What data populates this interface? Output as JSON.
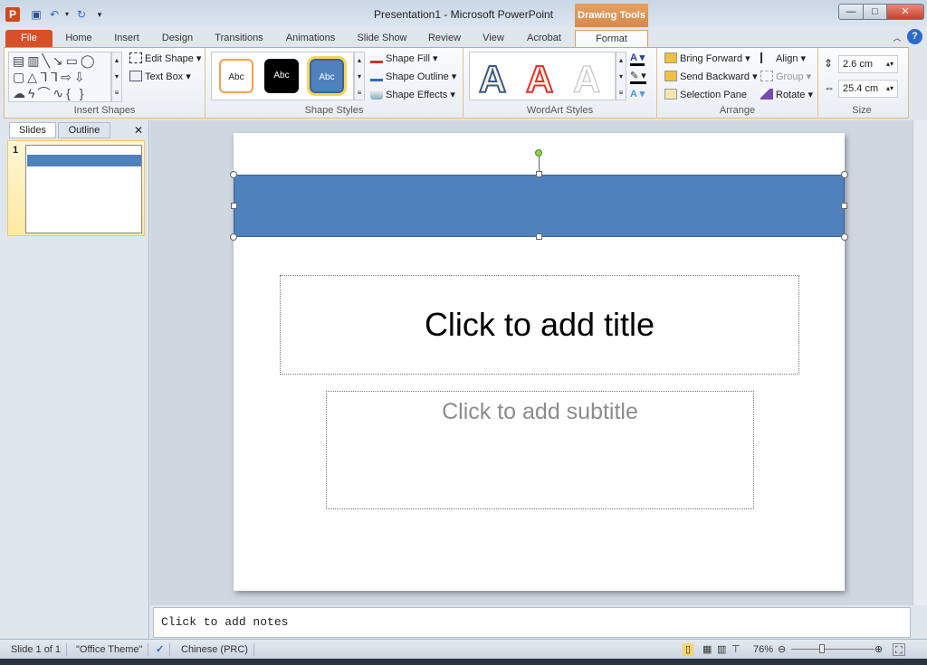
{
  "window": {
    "title": "Presentation1  -  Microsoft PowerPoint",
    "contextual_tab_group": "Drawing Tools",
    "controls": {
      "minimize": "—",
      "maximize": "□",
      "close": "✕"
    }
  },
  "quick_access": {
    "app_icon": "P",
    "save": "save-icon",
    "undo": "undo-icon",
    "redo": "redo-icon",
    "customize": "▾"
  },
  "tabs": [
    {
      "label": "File"
    },
    {
      "label": "Home"
    },
    {
      "label": "Insert"
    },
    {
      "label": "Design"
    },
    {
      "label": "Transitions"
    },
    {
      "label": "Animations"
    },
    {
      "label": "Slide Show"
    },
    {
      "label": "Review"
    },
    {
      "label": "View"
    },
    {
      "label": "Acrobat"
    },
    {
      "label": "Format",
      "active": true
    }
  ],
  "ribbon": {
    "insert_shapes": {
      "label": "Insert Shapes",
      "edit_shape": "Edit Shape",
      "text_box": "Text Box"
    },
    "shape_styles": {
      "label": "Shape Styles",
      "samples": [
        "Abc",
        "Abc",
        "Abc"
      ],
      "shape_fill": "Shape Fill",
      "shape_outline": "Shape Outline",
      "shape_effects": "Shape Effects"
    },
    "wordart_styles": {
      "label": "WordArt Styles",
      "samples": [
        "A",
        "A",
        "A"
      ]
    },
    "arrange": {
      "label": "Arrange",
      "bring_forward": "Bring Forward",
      "send_backward": "Send Backward",
      "selection_pane": "Selection Pane",
      "align": "Align",
      "group": "Group",
      "rotate": "Rotate"
    },
    "size": {
      "label": "Size",
      "height": "2.6 cm",
      "width": "25.4 cm"
    }
  },
  "left_panel": {
    "tabs": [
      "Slides",
      "Outline"
    ],
    "close": "✕",
    "slides": [
      {
        "number": "1"
      }
    ]
  },
  "slide": {
    "title_placeholder": "Click to add title",
    "subtitle_placeholder": "Click to add subtitle",
    "shape_color": "#4f81bd"
  },
  "notes": {
    "placeholder": "Click to add notes"
  },
  "status": {
    "slide": "Slide 1 of 1",
    "theme": "\"Office Theme\"",
    "language": "Chinese (PRC)",
    "zoom": "76%",
    "zoom_percent": 76
  },
  "colors": {
    "accent": "#d8502a",
    "contextual": "#d48a4c",
    "selected_shape": "#4f81bd"
  }
}
